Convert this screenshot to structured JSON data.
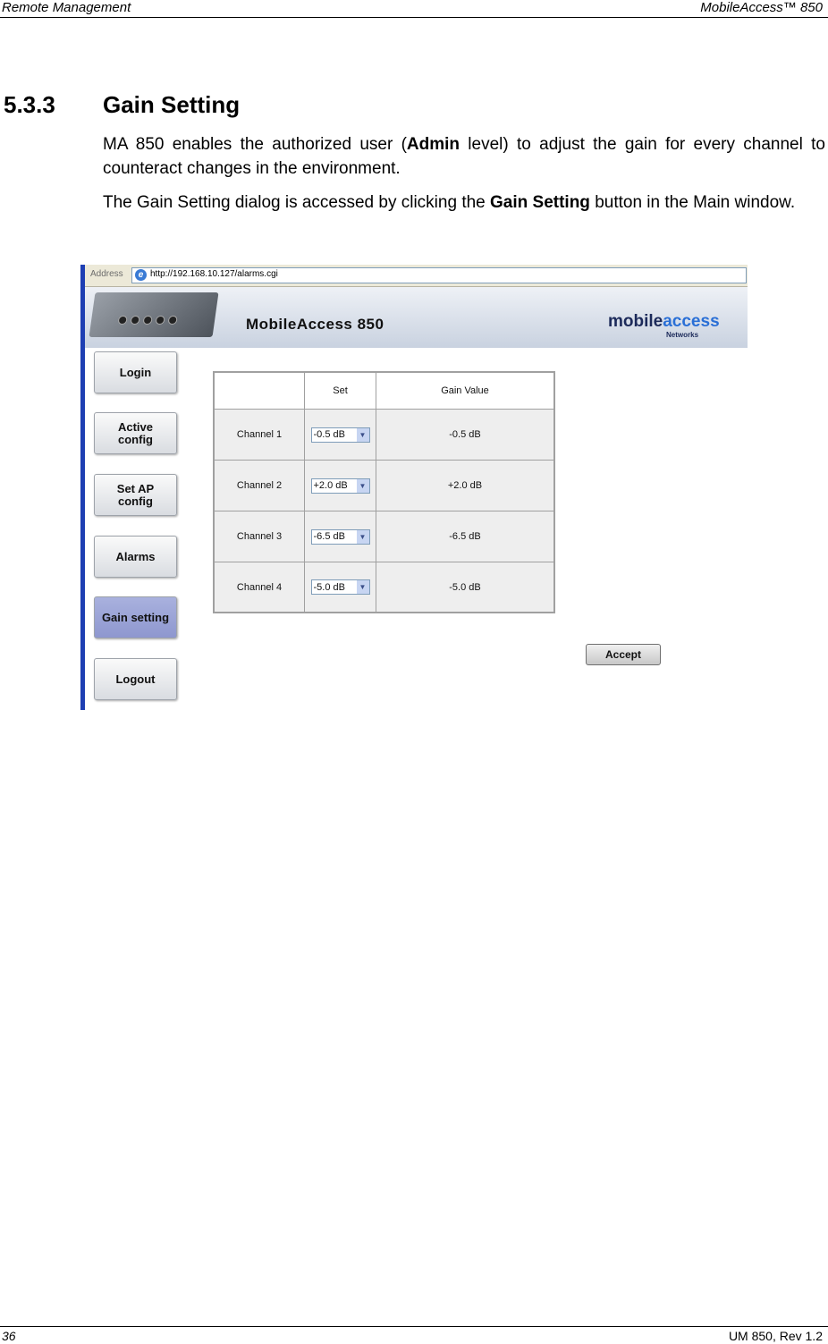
{
  "header": {
    "left": "Remote Management",
    "right": "MobileAccess™  850"
  },
  "section": {
    "number": "5.3.3",
    "title": "Gain Setting"
  },
  "paragraphs": {
    "p1_a": "MA 850 enables the authorized user (",
    "p1_bold": "Admin",
    "p1_b": " level) to adjust the gain for every channel to counteract changes in the environment.",
    "p2_a": "The Gain Setting dialog is accessed by clicking the ",
    "p2_bold": "Gain Setting",
    "p2_b": " button in the Main window."
  },
  "screenshot": {
    "address_label": "Address",
    "url": "http://192.168.10.127/alarms.cgi",
    "banner_title": "MobileAccess 850",
    "logo_main": "mobile",
    "logo_accent": "access",
    "logo_sub": "Networks",
    "nav": [
      {
        "label": "Login"
      },
      {
        "label": "Active\nconfig"
      },
      {
        "label": "Set AP\nconfig"
      },
      {
        "label": "Alarms"
      },
      {
        "label": "Gain setting",
        "active": true
      },
      {
        "label": "Logout"
      }
    ],
    "table": {
      "col_set": "Set",
      "col_gain": "Gain Value",
      "rows": [
        {
          "channel": "Channel 1",
          "set": "-0.5 dB",
          "gain": "-0.5  dB"
        },
        {
          "channel": "Channel 2",
          "set": "+2.0 dB",
          "gain": "+2.0  dB"
        },
        {
          "channel": "Channel 3",
          "set": "-6.5 dB",
          "gain": "-6.5  dB"
        },
        {
          "channel": "Channel 4",
          "set": "-5.0 dB",
          "gain": "-5.0  dB"
        }
      ]
    },
    "accept_label": "Accept"
  },
  "footer": {
    "page": "36",
    "doc": "UM 850, Rev 1.2"
  }
}
